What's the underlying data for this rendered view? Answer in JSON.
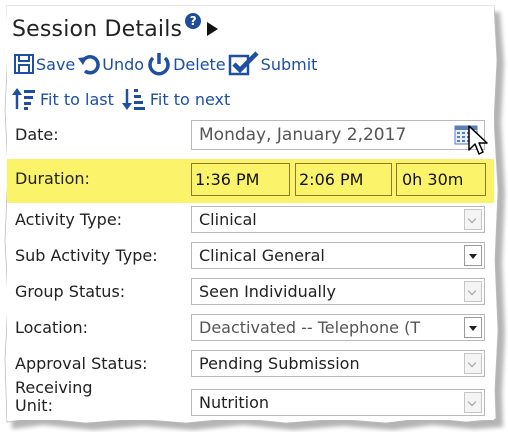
{
  "header": {
    "title": "Session Details"
  },
  "toolbar": {
    "save": "Save",
    "undo": "Undo",
    "delete": "Delete",
    "submit": "Submit"
  },
  "fit": {
    "last": "Fit to last",
    "next": "Fit to next"
  },
  "form": {
    "date": {
      "label": "Date:",
      "value": "Monday, January 2,2017"
    },
    "duration": {
      "label": "Duration:",
      "start": "1:36 PM",
      "end": "2:06 PM",
      "total": "0h 30m"
    },
    "activity_type": {
      "label": "Activity Type:",
      "value": "Clinical"
    },
    "sub_activity_type": {
      "label": "Sub Activity Type:",
      "value": "Clinical General"
    },
    "group_status": {
      "label": "Group Status:",
      "value": "Seen Individually"
    },
    "location": {
      "label": "Location:",
      "value": "Deactivated -- Telephone (T"
    },
    "approval_status": {
      "label": "Approval Status:",
      "value": "Pending Submission"
    },
    "receiving_unit": {
      "label_line1": "Receiving",
      "label_line2": "Unit:",
      "value": "Nutrition"
    }
  },
  "colors": {
    "link": "#1d4fa3",
    "highlight": "#fbf36a"
  },
  "icons": [
    "help-icon",
    "expand-arrow-icon",
    "save-icon",
    "undo-icon",
    "delete-icon",
    "submit-icon",
    "fit-to-last-icon",
    "fit-to-next-icon",
    "calendar-icon",
    "mouse-cursor-icon"
  ]
}
